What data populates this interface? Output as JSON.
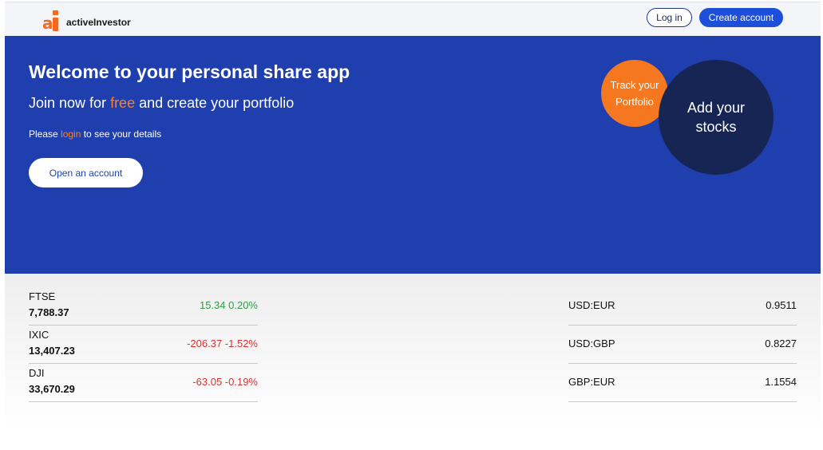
{
  "header": {
    "logo_mark": "ai",
    "brand": "activeInvestor",
    "login_label": "Log in",
    "create_label": "Create account"
  },
  "hero": {
    "title": "Welcome to your personal share app",
    "sub_prefix": "Join now for ",
    "sub_accent": "free",
    "sub_suffix": " and create your portfolio",
    "note_prefix": "Please ",
    "note_link": "login",
    "note_suffix": " to see your details",
    "open_account_label": "Open an account",
    "circle_track_line1": "Track your",
    "circle_track_line2": "Portfolio",
    "circle_add_line1": "Add your",
    "circle_add_line2": "stocks"
  },
  "indices": [
    {
      "name": "FTSE",
      "value": "7,788.37",
      "change": "15.34 0.20%",
      "direction": "up"
    },
    {
      "name": "IXIC",
      "value": "13,407.23",
      "change": "-206.37 -1.52%",
      "direction": "down"
    },
    {
      "name": "DJI",
      "value": "33,670.29",
      "change": "-63.05 -0.19%",
      "direction": "down"
    }
  ],
  "fx": [
    {
      "pair": "USD:EUR",
      "rate": "0.9511"
    },
    {
      "pair": "USD:GBP",
      "rate": "0.8227"
    },
    {
      "pair": "GBP:EUR",
      "rate": "1.1554"
    }
  ],
  "colors": {
    "brand_orange": "#f26a21",
    "hero_blue": "#1f3fae",
    "navy": "#172554",
    "positive": "#2f9e44",
    "negative": "#e03131"
  }
}
